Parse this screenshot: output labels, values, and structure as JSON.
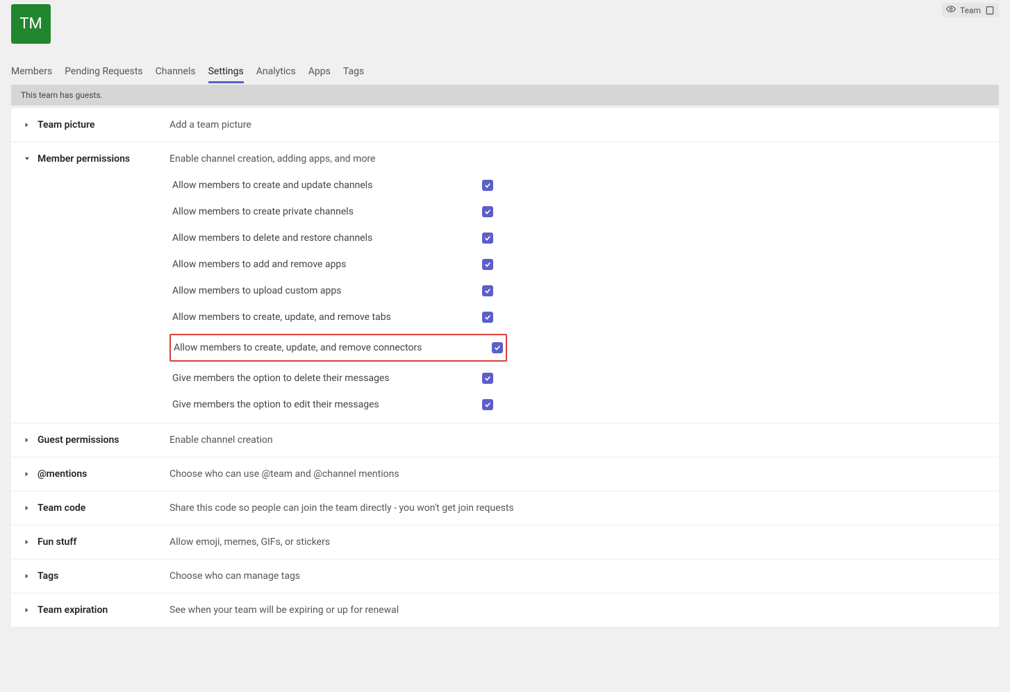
{
  "avatar_initials": "TM",
  "top_right": {
    "team_label": "Team"
  },
  "tabs": [
    {
      "label": "Members"
    },
    {
      "label": "Pending Requests"
    },
    {
      "label": "Channels"
    },
    {
      "label": "Settings",
      "active": true
    },
    {
      "label": "Analytics"
    },
    {
      "label": "Apps"
    },
    {
      "label": "Tags"
    }
  ],
  "notice": "This team has guests.",
  "sections": {
    "team_picture": {
      "title": "Team picture",
      "desc": "Add a team picture"
    },
    "member_permissions": {
      "title": "Member permissions",
      "desc": "Enable channel creation, adding apps, and more",
      "options": [
        {
          "label": "Allow members to create and update channels",
          "checked": true
        },
        {
          "label": "Allow members to create private channels",
          "checked": true
        },
        {
          "label": "Allow members to delete and restore channels",
          "checked": true
        },
        {
          "label": "Allow members to add and remove apps",
          "checked": true
        },
        {
          "label": "Allow members to upload custom apps",
          "checked": true
        },
        {
          "label": "Allow members to create, update, and remove tabs",
          "checked": true
        },
        {
          "label": "Allow members to create, update, and remove connectors",
          "checked": true,
          "highlight": true
        },
        {
          "label": "Give members the option to delete their messages",
          "checked": true
        },
        {
          "label": "Give members the option to edit their messages",
          "checked": true
        }
      ]
    },
    "guest_permissions": {
      "title": "Guest permissions",
      "desc": "Enable channel creation"
    },
    "mentions": {
      "title": "@mentions",
      "desc": "Choose who can use @team and @channel mentions"
    },
    "team_code": {
      "title": "Team code",
      "desc": "Share this code so people can join the team directly - you won't get join requests"
    },
    "fun_stuff": {
      "title": "Fun stuff",
      "desc": "Allow emoji, memes, GIFs, or stickers"
    },
    "tags_section": {
      "title": "Tags",
      "desc": "Choose who can manage tags"
    },
    "team_expiration": {
      "title": "Team expiration",
      "desc": "See when your team will be expiring or up for renewal"
    }
  }
}
